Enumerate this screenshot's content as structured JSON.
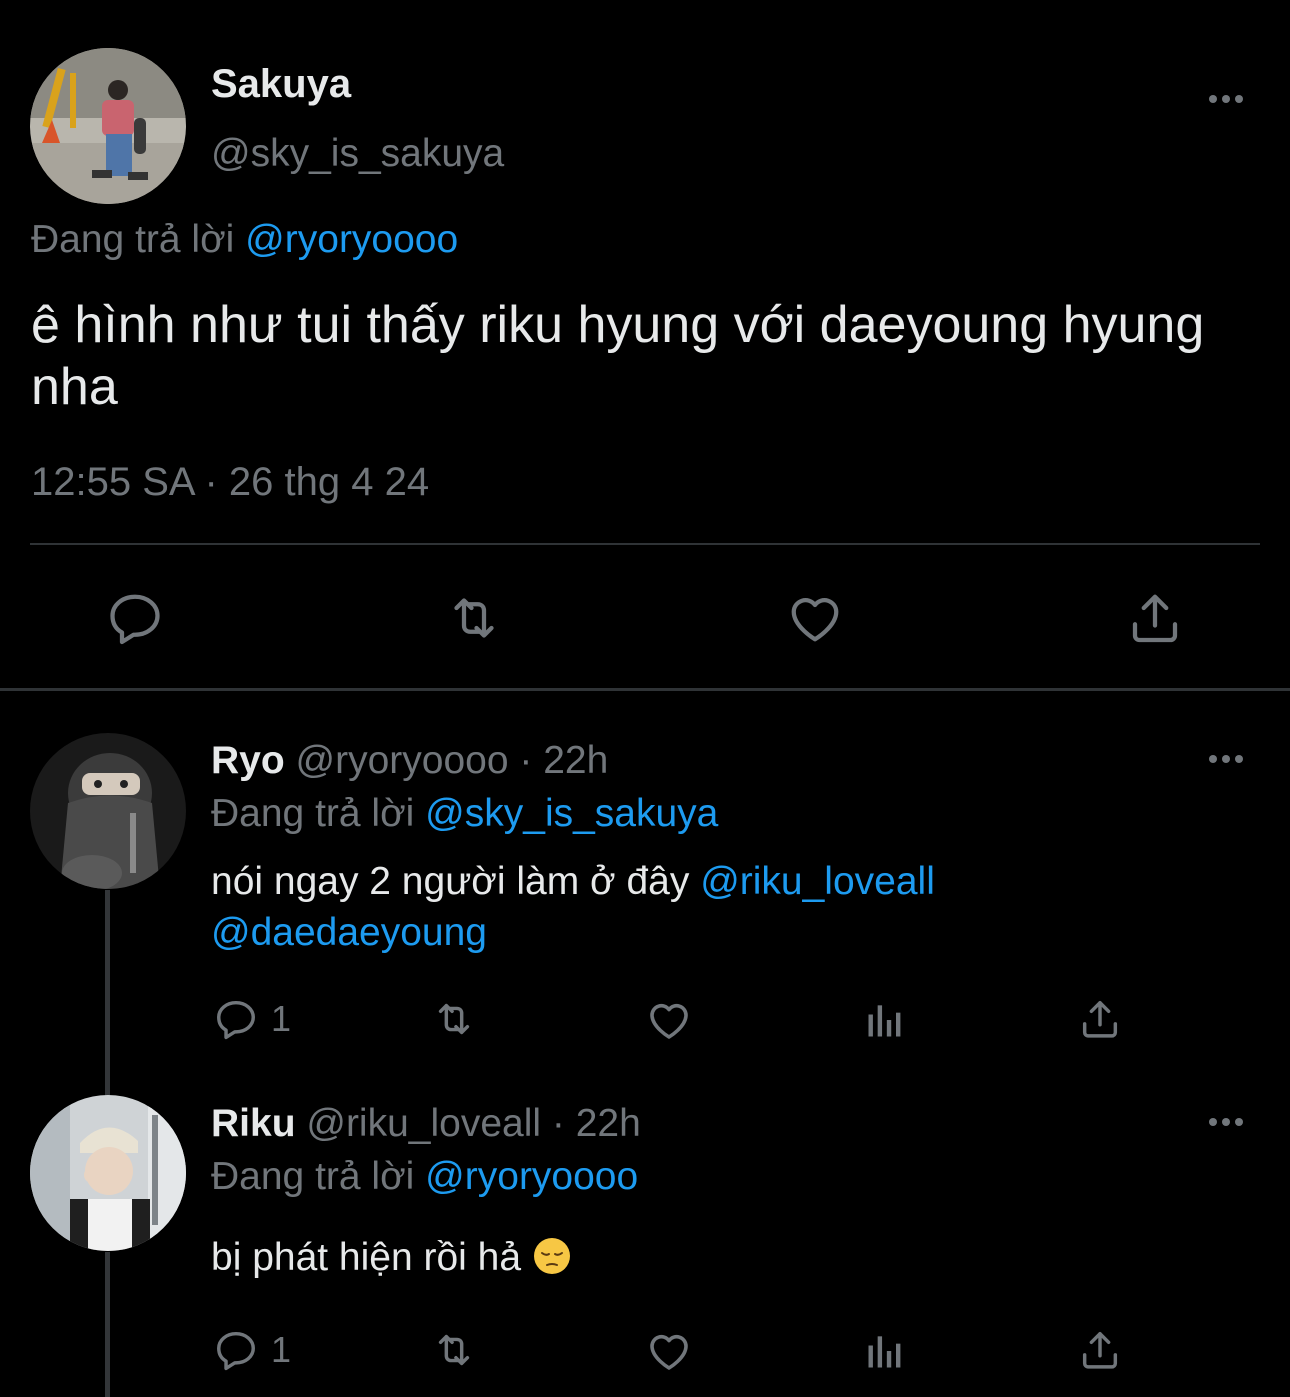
{
  "main_tweet": {
    "name": "Sakuya",
    "handle": "@sky_is_sakuya",
    "replying_label": "Đang trả lời",
    "replying_to": "@ryoryoooo",
    "text": "ê hình như tui thấy riku hyung với daeyoung hyung nha",
    "timestamp": "12:55 SA · 26 thg 4 24"
  },
  "replies": [
    {
      "name": "Ryo",
      "handle": "@ryoryoooo",
      "time": "· 22h",
      "replying_label": "Đang trả lời",
      "replying_to": "@sky_is_sakuya",
      "text": "nói ngay 2 người làm ở đây",
      "mention1": "@riku_loveall",
      "mention2": "@daedaeyoung",
      "reply_count": "1"
    },
    {
      "name": "Riku",
      "handle": "@riku_loveall",
      "time": "· 22h",
      "replying_label": "Đang trả lời",
      "replying_to": "@ryoryoooo",
      "text": "bị phát hiện rồi hả",
      "reply_count": "1"
    }
  ],
  "colors": {
    "background": "#000000",
    "text": "#e7e9ea",
    "muted": "#71767b",
    "accent": "#1d9bf0",
    "divider": "#2f3336"
  },
  "icons": [
    "reply-icon",
    "retweet-icon",
    "like-icon",
    "share-icon",
    "views-icon",
    "more-icon",
    "pensive-face-emoji"
  ]
}
